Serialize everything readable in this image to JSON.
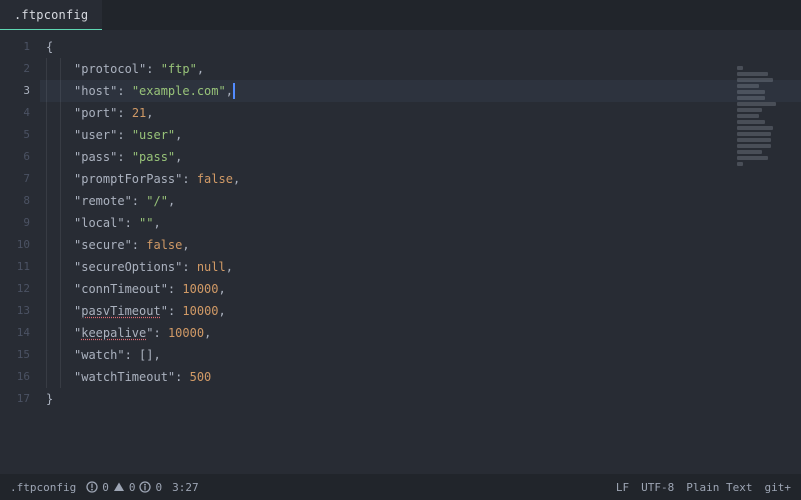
{
  "tab": {
    "title": ".ftpconfig"
  },
  "lines": [
    {
      "n": 1,
      "indent": 0,
      "segs": [
        {
          "t": "{",
          "c": "punc"
        }
      ]
    },
    {
      "n": 2,
      "indent": 2,
      "segs": [
        {
          "t": "\"protocol\"",
          "c": "key"
        },
        {
          "t": ": ",
          "c": "punc"
        },
        {
          "t": "\"ftp\"",
          "c": "str"
        },
        {
          "t": ",",
          "c": "punc"
        }
      ]
    },
    {
      "n": 3,
      "indent": 2,
      "active": true,
      "segs": [
        {
          "t": "\"host\"",
          "c": "key"
        },
        {
          "t": ": ",
          "c": "punc"
        },
        {
          "t": "\"example.com\"",
          "c": "str"
        },
        {
          "t": ",",
          "c": "punc"
        },
        {
          "cursor": true
        }
      ]
    },
    {
      "n": 4,
      "indent": 2,
      "segs": [
        {
          "t": "\"port\"",
          "c": "key"
        },
        {
          "t": ": ",
          "c": "punc"
        },
        {
          "t": "21",
          "c": "num"
        },
        {
          "t": ",",
          "c": "punc"
        }
      ]
    },
    {
      "n": 5,
      "indent": 2,
      "segs": [
        {
          "t": "\"user\"",
          "c": "key"
        },
        {
          "t": ": ",
          "c": "punc"
        },
        {
          "t": "\"user\"",
          "c": "str"
        },
        {
          "t": ",",
          "c": "punc"
        }
      ]
    },
    {
      "n": 6,
      "indent": 2,
      "segs": [
        {
          "t": "\"pass\"",
          "c": "key"
        },
        {
          "t": ": ",
          "c": "punc"
        },
        {
          "t": "\"pass\"",
          "c": "str"
        },
        {
          "t": ",",
          "c": "punc"
        }
      ]
    },
    {
      "n": 7,
      "indent": 2,
      "segs": [
        {
          "t": "\"promptForPass\"",
          "c": "key"
        },
        {
          "t": ": ",
          "c": "punc"
        },
        {
          "t": "false",
          "c": "const"
        },
        {
          "t": ",",
          "c": "punc"
        }
      ]
    },
    {
      "n": 8,
      "indent": 2,
      "segs": [
        {
          "t": "\"remote\"",
          "c": "key"
        },
        {
          "t": ": ",
          "c": "punc"
        },
        {
          "t": "\"/\"",
          "c": "str"
        },
        {
          "t": ",",
          "c": "punc"
        }
      ]
    },
    {
      "n": 9,
      "indent": 2,
      "segs": [
        {
          "t": "\"local\"",
          "c": "key"
        },
        {
          "t": ": ",
          "c": "punc"
        },
        {
          "t": "\"\"",
          "c": "str"
        },
        {
          "t": ",",
          "c": "punc"
        }
      ]
    },
    {
      "n": 10,
      "indent": 2,
      "segs": [
        {
          "t": "\"secure\"",
          "c": "key"
        },
        {
          "t": ": ",
          "c": "punc"
        },
        {
          "t": "false",
          "c": "const"
        },
        {
          "t": ",",
          "c": "punc"
        }
      ]
    },
    {
      "n": 11,
      "indent": 2,
      "segs": [
        {
          "t": "\"secureOptions\"",
          "c": "key"
        },
        {
          "t": ": ",
          "c": "punc"
        },
        {
          "t": "null",
          "c": "const"
        },
        {
          "t": ",",
          "c": "punc"
        }
      ]
    },
    {
      "n": 12,
      "indent": 2,
      "segs": [
        {
          "t": "\"connTimeout\"",
          "c": "key"
        },
        {
          "t": ": ",
          "c": "punc"
        },
        {
          "t": "10000",
          "c": "num"
        },
        {
          "t": ",",
          "c": "punc"
        }
      ]
    },
    {
      "n": 13,
      "indent": 2,
      "segs": [
        {
          "t": "\"",
          "c": "key"
        },
        {
          "t": "pasvTimeout",
          "c": "key",
          "err": true
        },
        {
          "t": "\"",
          "c": "key"
        },
        {
          "t": ": ",
          "c": "punc"
        },
        {
          "t": "10000",
          "c": "num"
        },
        {
          "t": ",",
          "c": "punc"
        }
      ]
    },
    {
      "n": 14,
      "indent": 2,
      "segs": [
        {
          "t": "\"",
          "c": "key"
        },
        {
          "t": "keepalive",
          "c": "key",
          "err": true
        },
        {
          "t": "\"",
          "c": "key"
        },
        {
          "t": ": ",
          "c": "punc"
        },
        {
          "t": "10000",
          "c": "num"
        },
        {
          "t": ",",
          "c": "punc"
        }
      ]
    },
    {
      "n": 15,
      "indent": 2,
      "segs": [
        {
          "t": "\"watch\"",
          "c": "key"
        },
        {
          "t": ": ",
          "c": "punc"
        },
        {
          "t": "[]",
          "c": "punc"
        },
        {
          "t": ",",
          "c": "punc"
        }
      ]
    },
    {
      "n": 16,
      "indent": 2,
      "segs": [
        {
          "t": "\"watchTimeout\"",
          "c": "key"
        },
        {
          "t": ": ",
          "c": "punc"
        },
        {
          "t": "500",
          "c": "num"
        }
      ]
    },
    {
      "n": 17,
      "indent": 0,
      "segs": [
        {
          "t": "}",
          "c": "punc"
        }
      ]
    }
  ],
  "status": {
    "filename": ".ftpconfig",
    "diag_issues": "0",
    "diag_warn": "0",
    "diag_info": "0",
    "cursor": "3:27",
    "line_ending": "LF",
    "encoding": "UTF-8",
    "grammar": "Plain Text",
    "git": "git+"
  }
}
